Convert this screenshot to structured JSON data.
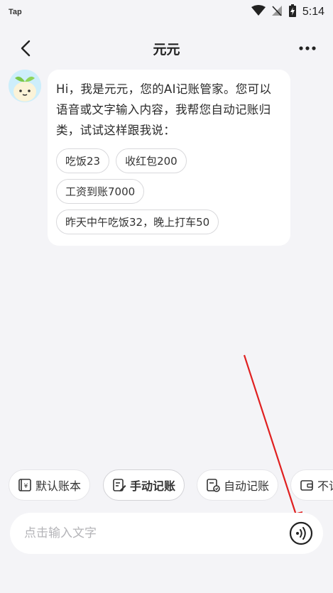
{
  "status_bar": {
    "app_label": "Tap",
    "time": "5:14"
  },
  "header": {
    "title": "元元"
  },
  "message": {
    "text": "Hi，我是元元，您的AI记账管家。您可以语音或文字输入内容，我帮您自动记账归类，试试这样跟我说：",
    "suggestions": [
      "吃饭23",
      "收红包200",
      "工资到账7000",
      "昨天中午吃饭32，晚上打车50"
    ]
  },
  "toolbar": {
    "buttons": [
      {
        "label": "默认账本",
        "icon": "ledger-icon"
      },
      {
        "label": "手动记账",
        "icon": "edit-icon"
      },
      {
        "label": "自动记账",
        "icon": "auto-record-icon"
      },
      {
        "label": "不记",
        "icon": "wallet-icon"
      }
    ]
  },
  "input": {
    "placeholder": "点击输入文字"
  },
  "colors": {
    "background": "#f4f4f7",
    "bubble": "#ffffff",
    "annotation_arrow": "#e02020"
  }
}
